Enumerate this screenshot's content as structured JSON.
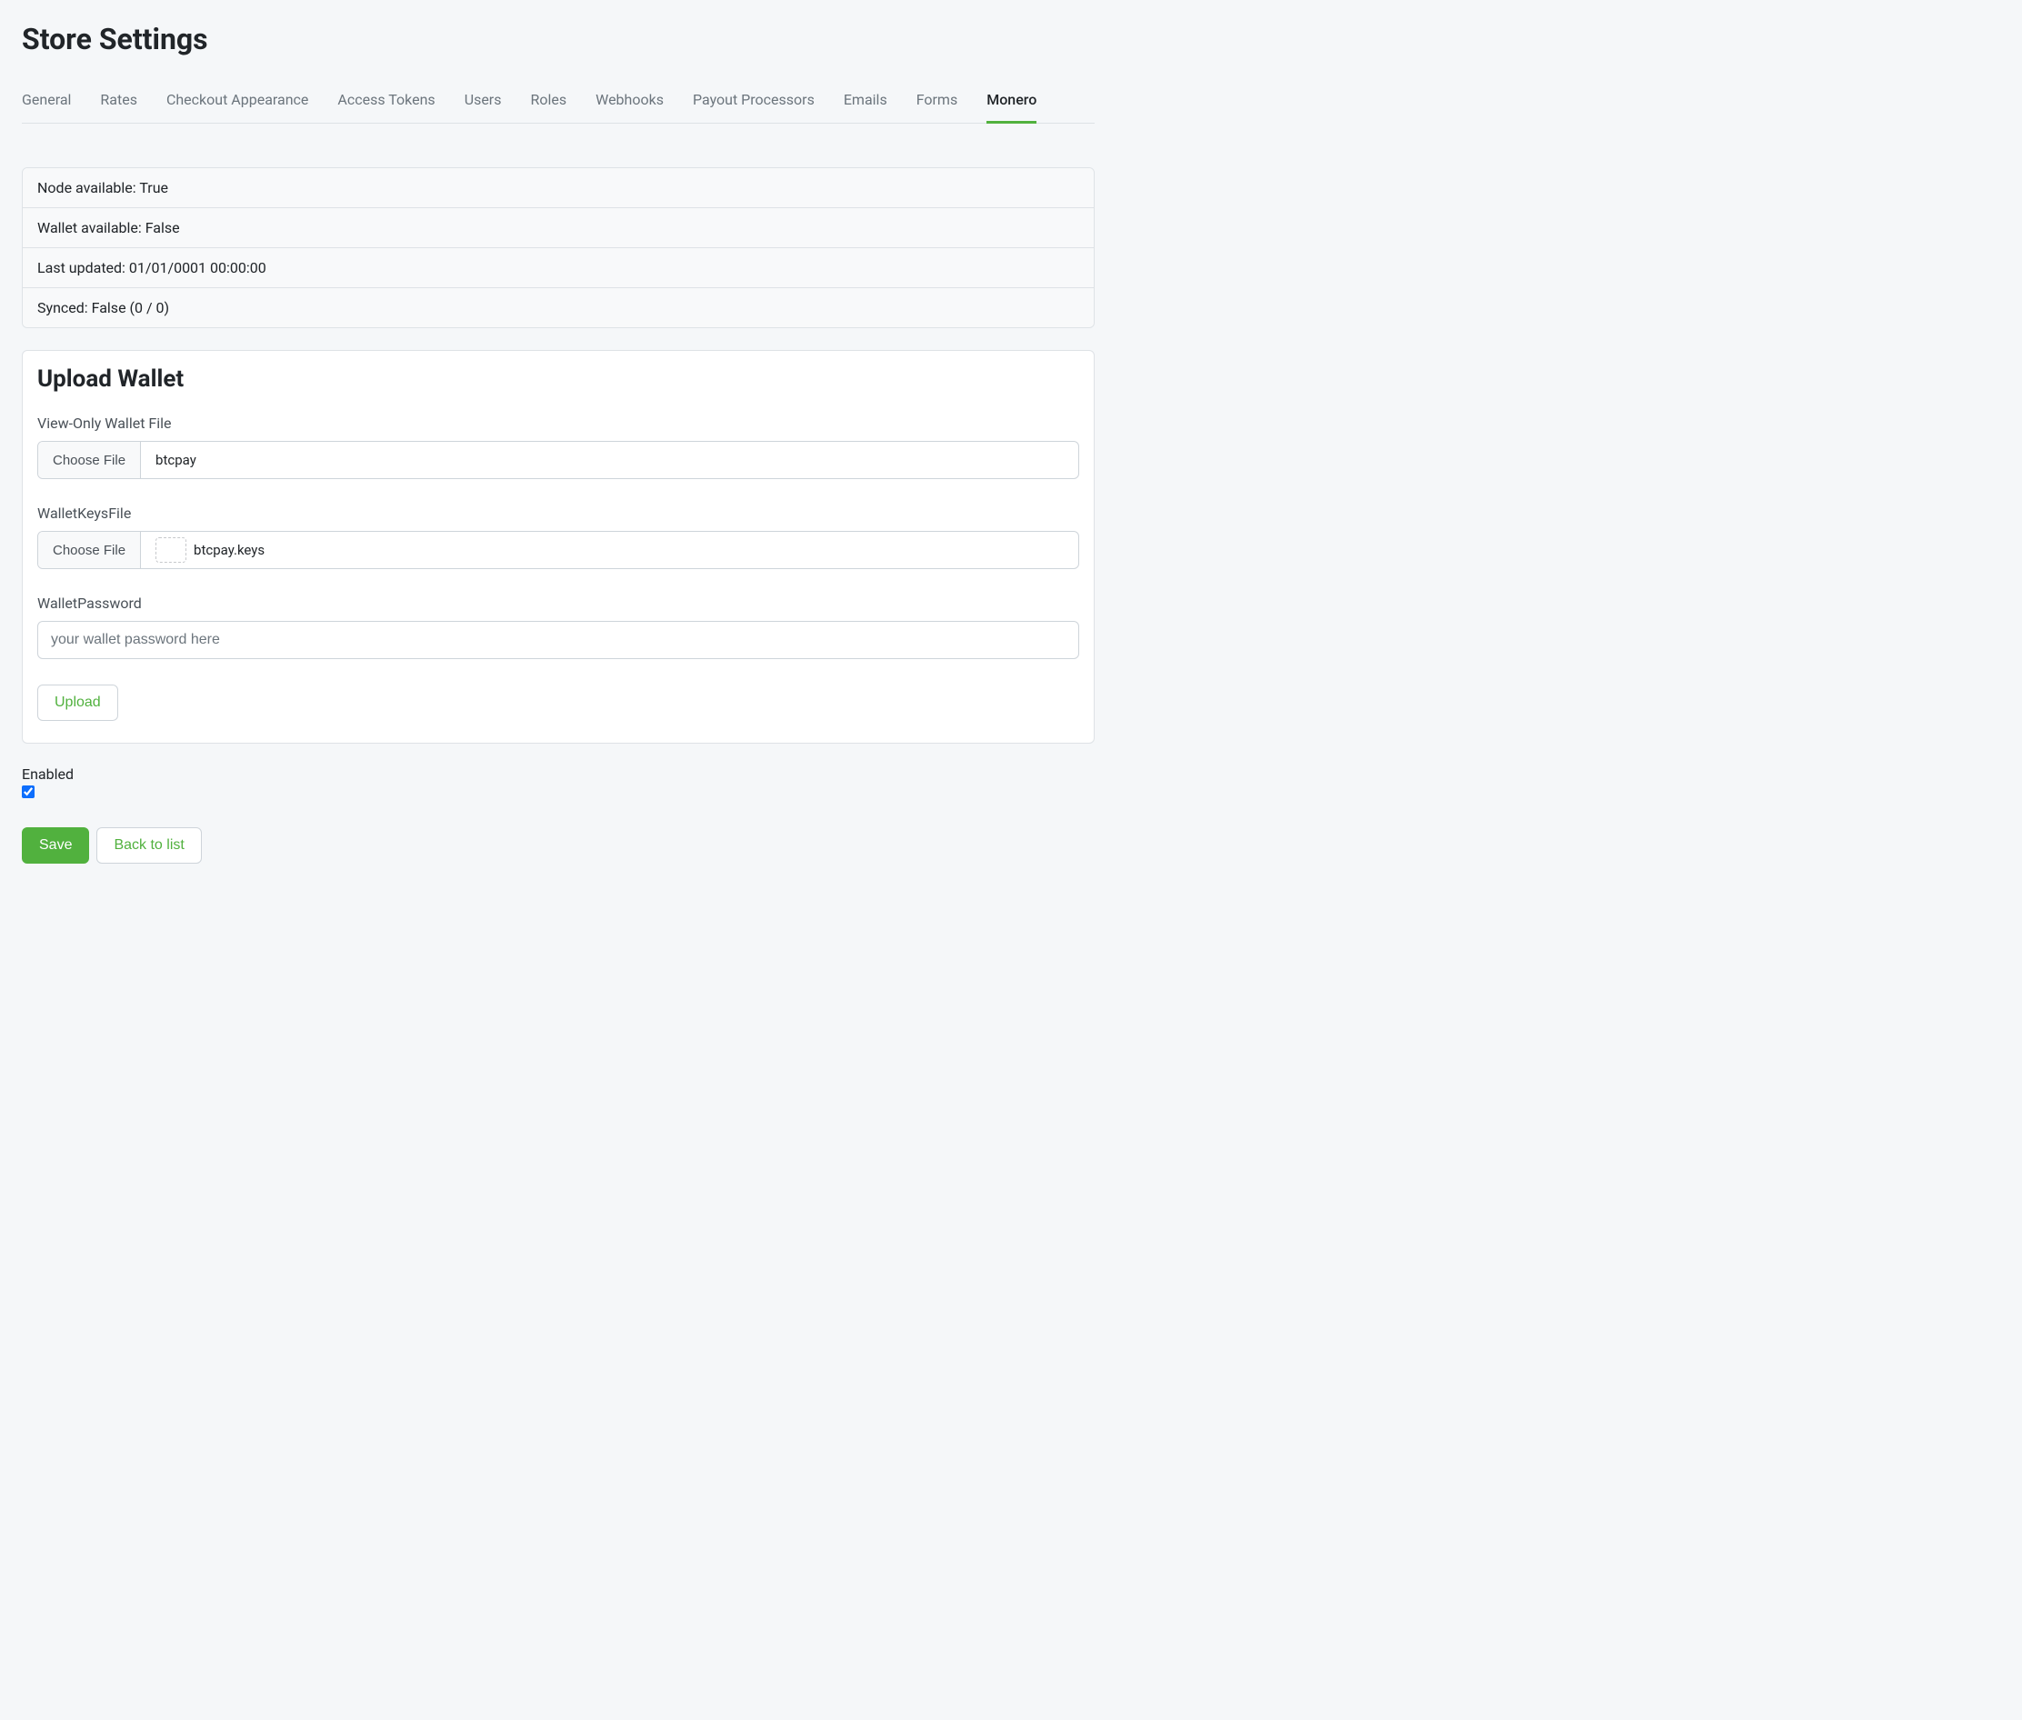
{
  "page": {
    "title": "Store Settings"
  },
  "tabs": [
    {
      "label": "General",
      "active": false
    },
    {
      "label": "Rates",
      "active": false
    },
    {
      "label": "Checkout Appearance",
      "active": false
    },
    {
      "label": "Access Tokens",
      "active": false
    },
    {
      "label": "Users",
      "active": false
    },
    {
      "label": "Roles",
      "active": false
    },
    {
      "label": "Webhooks",
      "active": false
    },
    {
      "label": "Payout Processors",
      "active": false
    },
    {
      "label": "Emails",
      "active": false
    },
    {
      "label": "Forms",
      "active": false
    },
    {
      "label": "Monero",
      "active": true
    }
  ],
  "status": {
    "node_available": "Node available: True",
    "wallet_available": "Wallet available: False",
    "last_updated": "Last updated: 01/01/0001 00:00:00",
    "synced": "Synced: False (0 / 0)"
  },
  "upload_wallet": {
    "heading": "Upload Wallet",
    "view_only_label": "View-Only Wallet File",
    "choose_file_label": "Choose File",
    "view_only_filename": "btcpay",
    "keys_label": "WalletKeysFile",
    "keys_filename": "btcpay.keys",
    "password_label": "WalletPassword",
    "password_placeholder": "your wallet password here",
    "upload_button": "Upload"
  },
  "enabled": {
    "label": "Enabled",
    "checked": true
  },
  "actions": {
    "save": "Save",
    "back": "Back to list"
  }
}
